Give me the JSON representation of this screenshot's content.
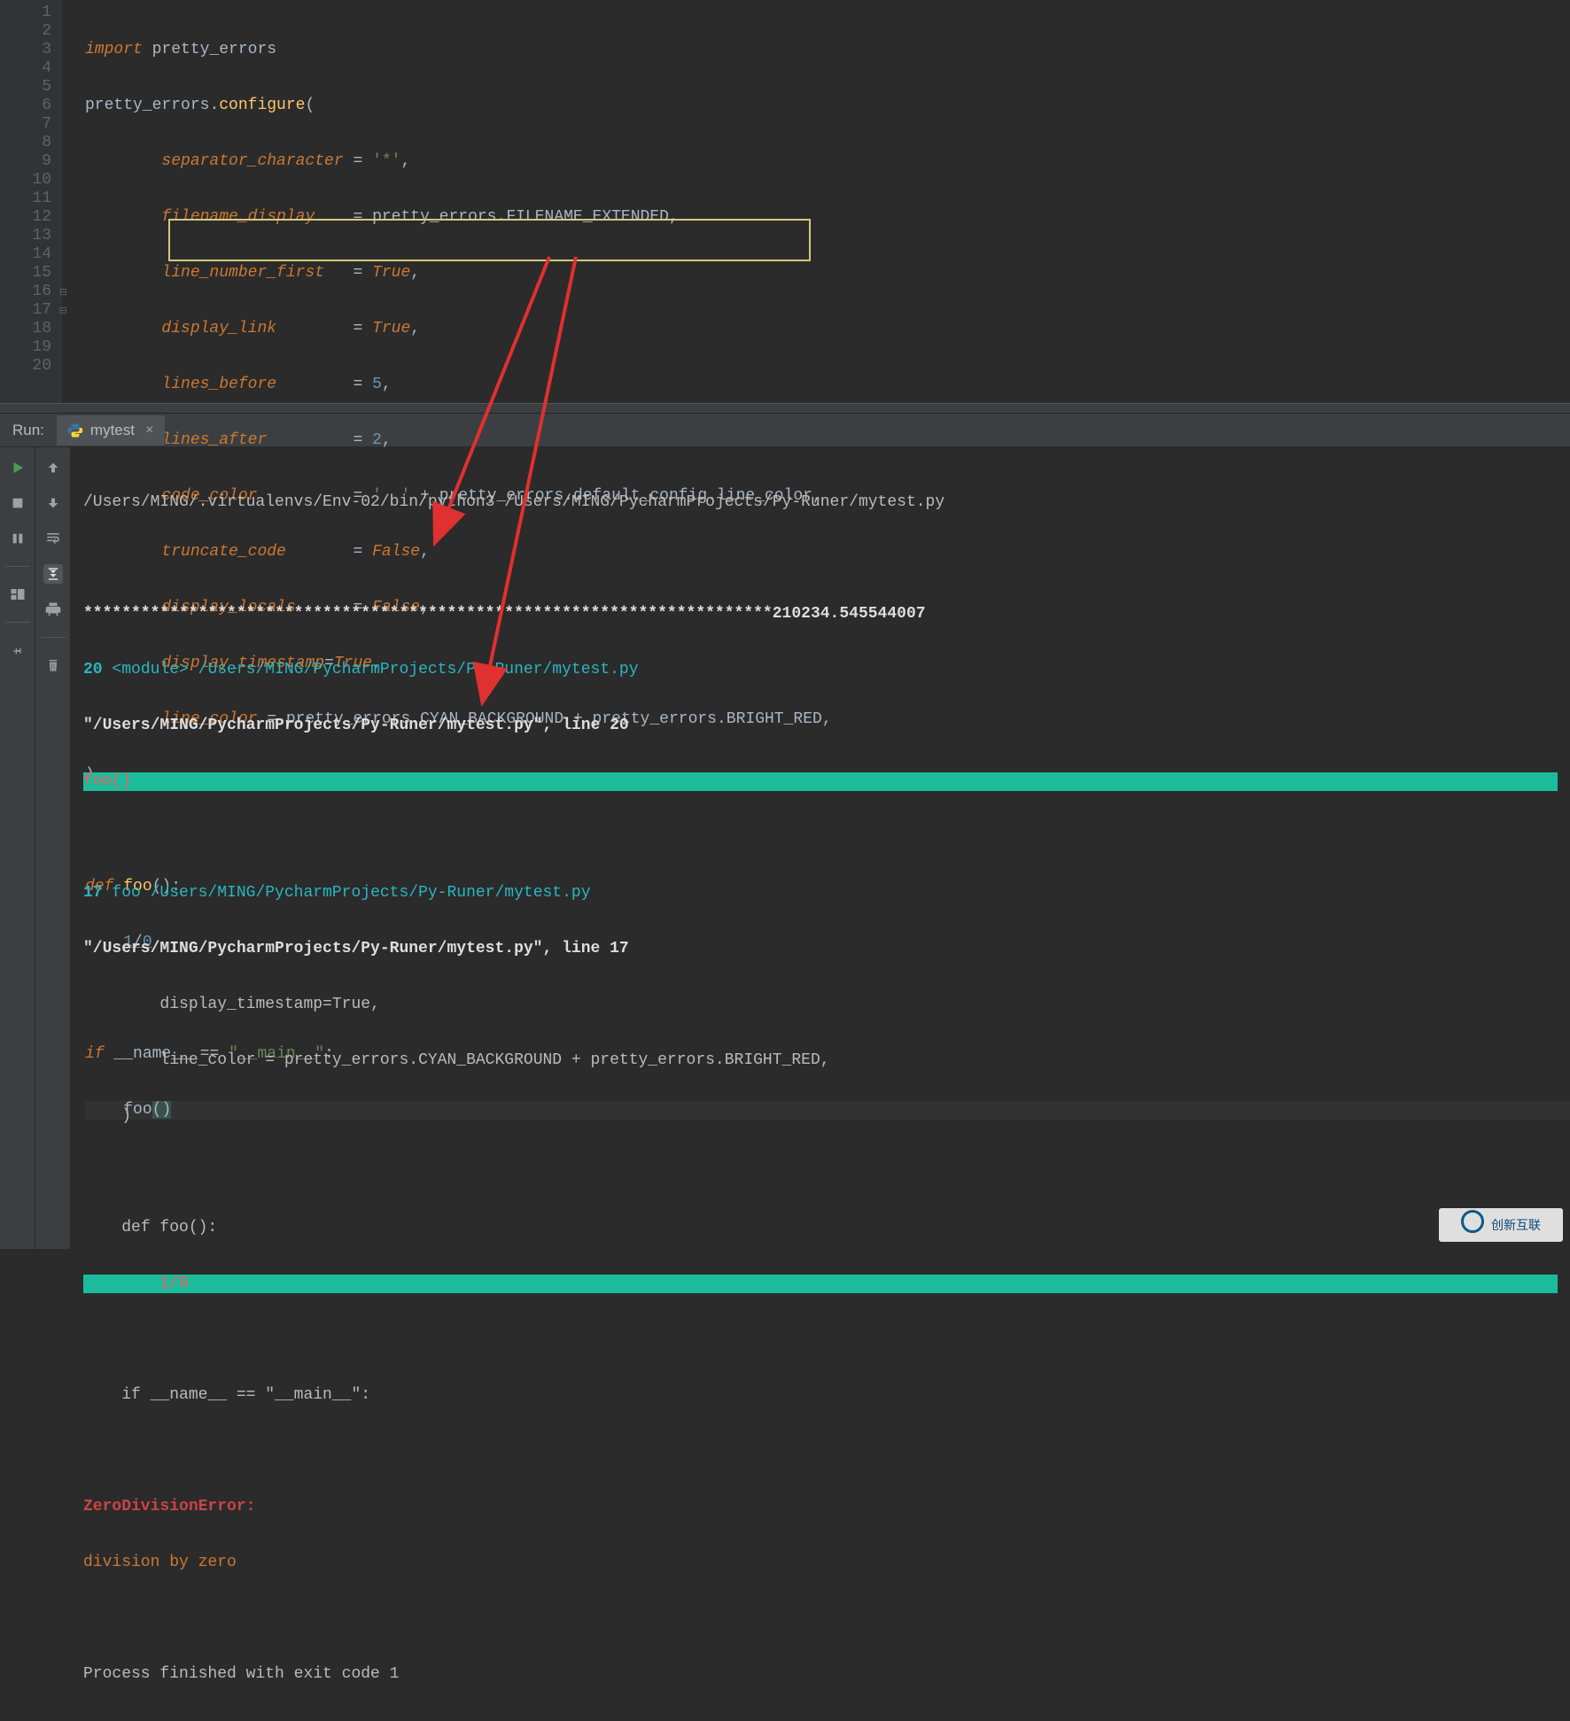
{
  "gutter": {
    "lines": [
      "1",
      "2",
      "3",
      "4",
      "5",
      "6",
      "7",
      "8",
      "9",
      "10",
      "11",
      "12",
      "13",
      "14",
      "15",
      "16",
      "17",
      "18",
      "19",
      "20"
    ]
  },
  "code": {
    "l1": {
      "kw": "import",
      "sp": " ",
      "id": "pretty_errors"
    },
    "l2": {
      "id": "pretty_errors",
      "dot": ".",
      "fn": "configure",
      "p1": "("
    },
    "l3": {
      "p": "separator_character",
      "eq": " = ",
      "v": "'*'",
      "c": ","
    },
    "l4": {
      "p": "filename_display",
      "eq": "    = ",
      "v1": "pretty_errors",
      "dot": ".",
      "v2": "FILENAME_EXTENDED",
      "c": ","
    },
    "l5": {
      "p": "line_number_first",
      "eq": "   = ",
      "v": "True",
      "c": ","
    },
    "l6": {
      "p": "display_link",
      "eq": "        = ",
      "v": "True",
      "c": ","
    },
    "l7": {
      "p": "lines_before",
      "eq": "        = ",
      "v": "5",
      "c": ","
    },
    "l8": {
      "p": "lines_after",
      "eq": "         = ",
      "v": "2",
      "c": ","
    },
    "l9": {
      "p": "code_color",
      "eq": "          = ",
      "v1": "'  '",
      "plus": " + ",
      "v2": "pretty_errors",
      "dot": ".",
      "v3": "default_config",
      "dot2": ".",
      "v4": "line_color",
      "c": ","
    },
    "l10": {
      "p": "truncate_code",
      "eq": "       = ",
      "v": "False",
      "c": ","
    },
    "l11": {
      "p": "display_locals",
      "eq": "      = ",
      "v": "False",
      "c": ","
    },
    "l12": {
      "p": "display_timestamp",
      "eq": "=",
      "v": "True",
      "c": ","
    },
    "l13": {
      "p": "line_color",
      "eq": " = ",
      "v1": "pretty_errors",
      "dot": ".",
      "v2": "CYAN_BACKGROUND",
      "plus": " + ",
      "v3": "pretty_errors",
      "dot2": ".",
      "v4": "BRIGHT_RED",
      "c": ","
    },
    "l14": {
      "p": ")"
    },
    "l16": {
      "kw": "def",
      "sp": " ",
      "fn": "foo",
      "p": "():"
    },
    "l17": {
      "n1": "1",
      "op": "/",
      "n2": "0"
    },
    "l19": {
      "kw": "if",
      "sp": " ",
      "id": "__name__",
      "eq": " == ",
      "str": "\"__main__\"",
      "c": ":"
    },
    "l20": {
      "fn": "foo",
      "p1": "(",
      ")": ")"
    }
  },
  "run": {
    "label": "Run:",
    "tab_name": "mytest",
    "tab_close": "×"
  },
  "console": {
    "l1": "/Users/MING/.virtualenvs/Env-02/bin/python3 /Users/MING/PycharmProjects/Py-Runer/mytest.py",
    "l3_stars": "************************************************************************",
    "l3_ts": "210234.545544007",
    "l4_num": "20",
    "l4_mod": " <module> ",
    "l4_path": "/Users/MING/PycharmProjects/Py-Runer/mytest.py",
    "l5_path": "\"/Users/MING/PycharmProjects/Py-Runer/mytest.py\", line 20",
    "l6": "foo()",
    "l8_num": "17",
    "l8_fn": " foo ",
    "l8_path": "/Users/MING/PycharmProjects/Py-Runer/mytest.py",
    "l9_path": "\"/Users/MING/PycharmProjects/Py-Runer/mytest.py\", line 17",
    "l10": "        display_timestamp=True,",
    "l11": "        line_color = pretty_errors.CYAN_BACKGROUND + pretty_errors.BRIGHT_RED,",
    "l12": "    )",
    "l14": "    def foo():",
    "l15_indent": "        ",
    "l15_code": "1/0",
    "l17": "    if __name__ == \"__main__\":",
    "l19_err": "ZeroDivisionError:",
    "l20_msg": "division by zero",
    "l22": "Process finished with exit code 1"
  },
  "watermark": "创新互联"
}
